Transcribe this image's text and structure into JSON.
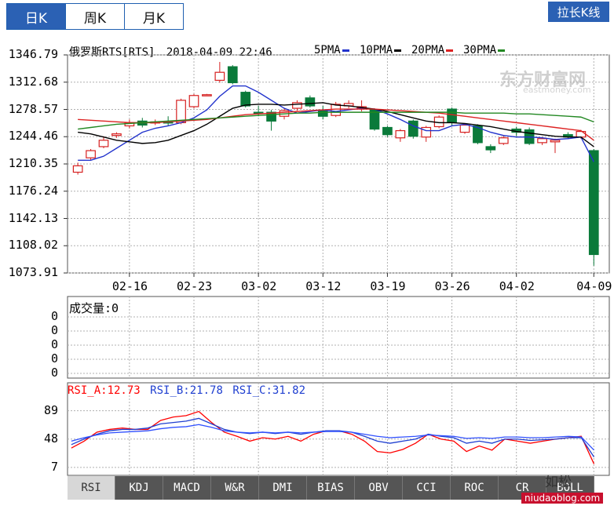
{
  "tabs": [
    {
      "label": "日K",
      "active": true
    },
    {
      "label": "周K",
      "active": false
    },
    {
      "label": "月K",
      "active": false
    }
  ],
  "stretch_button": "拉长K线",
  "header": {
    "name": "俄罗斯RTS[RTS]",
    "datetime": "2018-04-09 22:46"
  },
  "legend": [
    {
      "label": "5PMA",
      "color": "#2233cc"
    },
    {
      "label": "10PMA",
      "color": "#000000"
    },
    {
      "label": "20PMA",
      "color": "#dd2222"
    },
    {
      "label": "30PMA",
      "color": "#228822"
    }
  ],
  "watermark": {
    "name": "东方财富网",
    "url": "eastmoney.com"
  },
  "colors": {
    "up": "#d62020",
    "down": "#0a7a3a",
    "grid": "#b0b0b0",
    "rsi_a": "#ff0000",
    "rsi_b": "#1f3fd0",
    "rsi_c": "#3050ff"
  },
  "chart_data": [
    {
      "type": "candlestick",
      "title": "",
      "y_ticks": [
        "1346.79",
        "1312.68",
        "1278.57",
        "1244.46",
        "1210.35",
        "1176.24",
        "1142.13",
        "1108.02",
        "1073.91"
      ],
      "ylim": [
        1073.91,
        1346.79
      ],
      "x_ticks": [
        "02-16",
        "02-23",
        "03-02",
        "03-12",
        "03-19",
        "03-26",
        "04-02",
        "04-09"
      ],
      "candles": [
        {
          "o": 1200,
          "c": 1208,
          "h": 1212,
          "l": 1197
        },
        {
          "o": 1218,
          "c": 1227,
          "h": 1229,
          "l": 1215
        },
        {
          "o": 1232,
          "c": 1240,
          "h": 1245,
          "l": 1230
        },
        {
          "o": 1246,
          "c": 1248,
          "h": 1250,
          "l": 1243
        },
        {
          "o": 1258,
          "c": 1262,
          "h": 1266,
          "l": 1255
        },
        {
          "o": 1264,
          "c": 1259,
          "h": 1268,
          "l": 1256
        },
        {
          "o": 1262,
          "c": 1263,
          "h": 1266,
          "l": 1259
        },
        {
          "o": 1263,
          "c": 1262,
          "h": 1270,
          "l": 1258
        },
        {
          "o": 1262,
          "c": 1290,
          "h": 1292,
          "l": 1260
        },
        {
          "o": 1282,
          "c": 1296,
          "h": 1298,
          "l": 1280
        },
        {
          "o": 1297,
          "c": 1297,
          "h": 1298,
          "l": 1296
        },
        {
          "o": 1315,
          "c": 1325,
          "h": 1338,
          "l": 1312
        },
        {
          "o": 1332,
          "c": 1312,
          "h": 1334,
          "l": 1310
        },
        {
          "o": 1300,
          "c": 1283,
          "h": 1302,
          "l": 1281
        },
        {
          "o": 1275,
          "c": 1274,
          "h": 1283,
          "l": 1270
        },
        {
          "o": 1275,
          "c": 1264,
          "h": 1278,
          "l": 1252
        },
        {
          "o": 1270,
          "c": 1277,
          "h": 1280,
          "l": 1266
        },
        {
          "o": 1280,
          "c": 1287,
          "h": 1290,
          "l": 1277
        },
        {
          "o": 1293,
          "c": 1283,
          "h": 1296,
          "l": 1281
        },
        {
          "o": 1278,
          "c": 1270,
          "h": 1283,
          "l": 1266
        },
        {
          "o": 1271,
          "c": 1285,
          "h": 1288,
          "l": 1269
        },
        {
          "o": 1283,
          "c": 1286,
          "h": 1290,
          "l": 1280
        },
        {
          "o": 1281,
          "c": 1282,
          "h": 1290,
          "l": 1276
        },
        {
          "o": 1278,
          "c": 1254,
          "h": 1280,
          "l": 1252
        },
        {
          "o": 1256,
          "c": 1247,
          "h": 1258,
          "l": 1244
        },
        {
          "o": 1243,
          "c": 1252,
          "h": 1254,
          "l": 1238
        },
        {
          "o": 1264,
          "c": 1245,
          "h": 1266,
          "l": 1242
        },
        {
          "o": 1244,
          "c": 1256,
          "h": 1258,
          "l": 1238
        },
        {
          "o": 1257,
          "c": 1269,
          "h": 1271,
          "l": 1255
        },
        {
          "o": 1279,
          "c": 1262,
          "h": 1281,
          "l": 1258
        },
        {
          "o": 1250,
          "c": 1259,
          "h": 1261,
          "l": 1248
        },
        {
          "o": 1258,
          "c": 1237,
          "h": 1260,
          "l": 1235
        },
        {
          "o": 1232,
          "c": 1228,
          "h": 1235,
          "l": 1224
        },
        {
          "o": 1236,
          "c": 1243,
          "h": 1246,
          "l": 1234
        },
        {
          "o": 1254,
          "c": 1250,
          "h": 1257,
          "l": 1245
        },
        {
          "o": 1253,
          "c": 1236,
          "h": 1256,
          "l": 1234
        },
        {
          "o": 1237,
          "c": 1242,
          "h": 1244,
          "l": 1234
        },
        {
          "o": 1238,
          "c": 1240,
          "h": 1242,
          "l": 1224
        },
        {
          "o": 1247,
          "c": 1244,
          "h": 1250,
          "l": 1242
        },
        {
          "o": 1244,
          "c": 1251,
          "h": 1253,
          "l": 1242
        },
        {
          "o": 1227,
          "c": 1097,
          "h": 1229,
          "l": 1083
        }
      ],
      "ma5": [
        1215,
        1215,
        1220,
        1230,
        1240,
        1250,
        1255,
        1258,
        1262,
        1268,
        1278,
        1295,
        1308,
        1308,
        1300,
        1290,
        1280,
        1274,
        1276,
        1278,
        1276,
        1278,
        1280,
        1279,
        1273,
        1266,
        1258,
        1252,
        1252,
        1258,
        1260,
        1256,
        1250,
        1246,
        1244,
        1244,
        1243,
        1241,
        1242,
        1244,
        1213
      ],
      "ma10": [
        1250,
        1248,
        1244,
        1240,
        1238,
        1236,
        1237,
        1240,
        1246,
        1252,
        1260,
        1270,
        1280,
        1284,
        1285,
        1285,
        1284,
        1285,
        1286,
        1287,
        1284,
        1283,
        1281,
        1279,
        1276,
        1272,
        1268,
        1264,
        1262,
        1262,
        1261,
        1259,
        1257,
        1254,
        1251,
        1249,
        1247,
        1245,
        1244,
        1244,
        1232
      ],
      "ma20": [
        1266,
        1265,
        1264,
        1263,
        1262,
        1262,
        1262,
        1263,
        1264,
        1265,
        1266,
        1268,
        1270,
        1272,
        1273,
        1274,
        1275,
        1276,
        1277,
        1278,
        1279,
        1279,
        1279,
        1279,
        1278,
        1277,
        1276,
        1275,
        1274,
        1272,
        1270,
        1268,
        1266,
        1264,
        1262,
        1260,
        1258,
        1256,
        1254,
        1252,
        1240
      ],
      "ma30": [
        1254,
        1256,
        1258,
        1260,
        1261,
        1262,
        1263,
        1264,
        1265,
        1266,
        1267,
        1268,
        1269,
        1270,
        1271,
        1272,
        1273,
        1274,
        1274,
        1275,
        1275,
        1275,
        1275,
        1275,
        1275,
        1275,
        1275,
        1275,
        1275,
        1275,
        1274,
        1274,
        1274,
        1274,
        1273,
        1273,
        1272,
        1271,
        1270,
        1269,
        1263
      ]
    },
    {
      "type": "bar",
      "title": "成交量",
      "value_label": "成交量:0",
      "y_ticks": [
        "0",
        "0",
        "0",
        "0",
        "0"
      ]
    },
    {
      "type": "line",
      "label_a": "RSI_A:12.73",
      "label_b": "RSI_B:21.78",
      "label_c": "RSI_C:31.82",
      "y_ticks": [
        "89",
        "48",
        "7"
      ],
      "ylim": [
        0,
        100
      ],
      "series": [
        {
          "name": "RSI_A",
          "values": [
            35,
            45,
            58,
            62,
            64,
            62,
            62,
            75,
            80,
            82,
            88,
            72,
            58,
            52,
            45,
            50,
            48,
            52,
            45,
            55,
            60,
            60,
            55,
            45,
            30,
            28,
            33,
            42,
            55,
            48,
            45,
            30,
            38,
            32,
            48,
            45,
            42,
            45,
            48,
            50,
            52,
            12
          ]
        },
        {
          "name": "RSI_B",
          "values": [
            40,
            48,
            55,
            60,
            62,
            62,
            64,
            70,
            72,
            74,
            78,
            70,
            62,
            58,
            56,
            58,
            56,
            58,
            55,
            58,
            60,
            60,
            58,
            52,
            45,
            42,
            45,
            48,
            55,
            52,
            50,
            42,
            45,
            42,
            48,
            48,
            46,
            47,
            48,
            50,
            50,
            22
          ]
        },
        {
          "name": "RSI_C",
          "values": [
            45,
            50,
            54,
            57,
            58,
            59,
            60,
            63,
            65,
            66,
            69,
            65,
            60,
            58,
            57,
            58,
            57,
            58,
            57,
            58,
            59,
            59,
            58,
            55,
            52,
            50,
            51,
            52,
            54,
            53,
            52,
            49,
            50,
            49,
            51,
            51,
            50,
            50,
            51,
            52,
            51,
            32
          ]
        }
      ]
    }
  ],
  "indicator_buttons": [
    {
      "label": "RSI",
      "active": true
    },
    {
      "label": "KDJ",
      "active": false
    },
    {
      "label": "MACD",
      "active": false
    },
    {
      "label": "W&R",
      "active": false
    },
    {
      "label": "DMI",
      "active": false
    },
    {
      "label": "BIAS",
      "active": false
    },
    {
      "label": "OBV",
      "active": false
    },
    {
      "label": "CCI",
      "active": false
    },
    {
      "label": "ROC",
      "active": false
    },
    {
      "label": "CR",
      "active": false
    },
    {
      "label": "BOLL",
      "active": false
    }
  ],
  "blog_badge": {
    "name": "如松",
    "url": "niudaoblog.com"
  }
}
